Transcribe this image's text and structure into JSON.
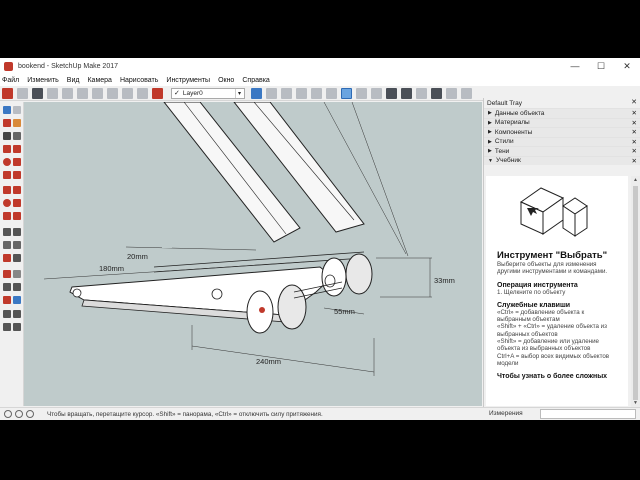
{
  "window": {
    "title": "bookend - SketchUp Make 2017",
    "minimize": "—",
    "maximize": "☐",
    "close": "✕"
  },
  "menu": [
    "Файл",
    "Изменить",
    "Вид",
    "Камера",
    "Нарисовать",
    "Инструменты",
    "Окно",
    "Справка"
  ],
  "toolbar": {
    "layer_value": "Layer0",
    "layer_check": "✓",
    "layer_chevron": "▾"
  },
  "dimensions": {
    "d1": "180mm",
    "d2": "20mm",
    "d3": "33mm",
    "d4": "55mm",
    "d5": "240mm"
  },
  "tray": {
    "title": "Default Tray",
    "sections": [
      {
        "label": "Данные объекта",
        "open": false
      },
      {
        "label": "Материалы",
        "open": false
      },
      {
        "label": "Компоненты",
        "open": false
      },
      {
        "label": "Стили",
        "open": false
      },
      {
        "label": "Тени",
        "open": false
      },
      {
        "label": "Учебник",
        "open": true
      }
    ],
    "instructor": {
      "heading": "Инструмент \"Выбрать\"",
      "intro": "Выберите объекты для изменения другими инструментами и командами.",
      "op_heading": "Операция инструмента",
      "op_step": "1.  Щелкните по объекту",
      "keys_heading": "Служебные клавиши",
      "keys_lines": [
        "«Ctrl» = добавление объекта к выбранным объектам",
        "«Shift» + «Ctrl» = удаление объекта из выбранных объектов",
        "«Shift» = добавление или удаление объекта из выбранных объектов",
        "Ctrl+A = выбор всех видимых объектов модели"
      ],
      "more": "Чтобы узнать о более сложных"
    }
  },
  "status": {
    "text": "Чтобы вращать, перетащите курсор. «Shift» = панорама, «Ctrl» = отключить силу притяжения.",
    "measure_label": "Измерения",
    "measure_value": ""
  },
  "colors": {
    "viewport_bg": "#bfcbcb",
    "accent": "#c0392b"
  }
}
